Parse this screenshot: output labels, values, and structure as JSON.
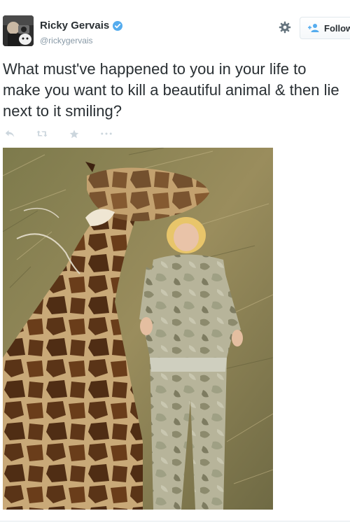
{
  "author": {
    "display_name": "Ricky Gervais",
    "screen_name": "@rickygervais"
  },
  "header": {
    "follow_label": "Follow"
  },
  "tweet": {
    "text": "What must've happened to you in your life to make you want to kill a beautiful animal & then lie next to it smiling?"
  },
  "actions": [
    {
      "name": "reply",
      "icon": "reply-icon"
    },
    {
      "name": "retweet",
      "icon": "retweet-icon"
    },
    {
      "name": "favorite",
      "icon": "star-icon"
    },
    {
      "name": "more",
      "icon": "more-icon"
    }
  ],
  "colors": {
    "text": "#292f33",
    "muted": "#8899a6",
    "verified": "#55acee",
    "follow_icon": "#55acee",
    "action_icon": "#ccd6dd"
  }
}
